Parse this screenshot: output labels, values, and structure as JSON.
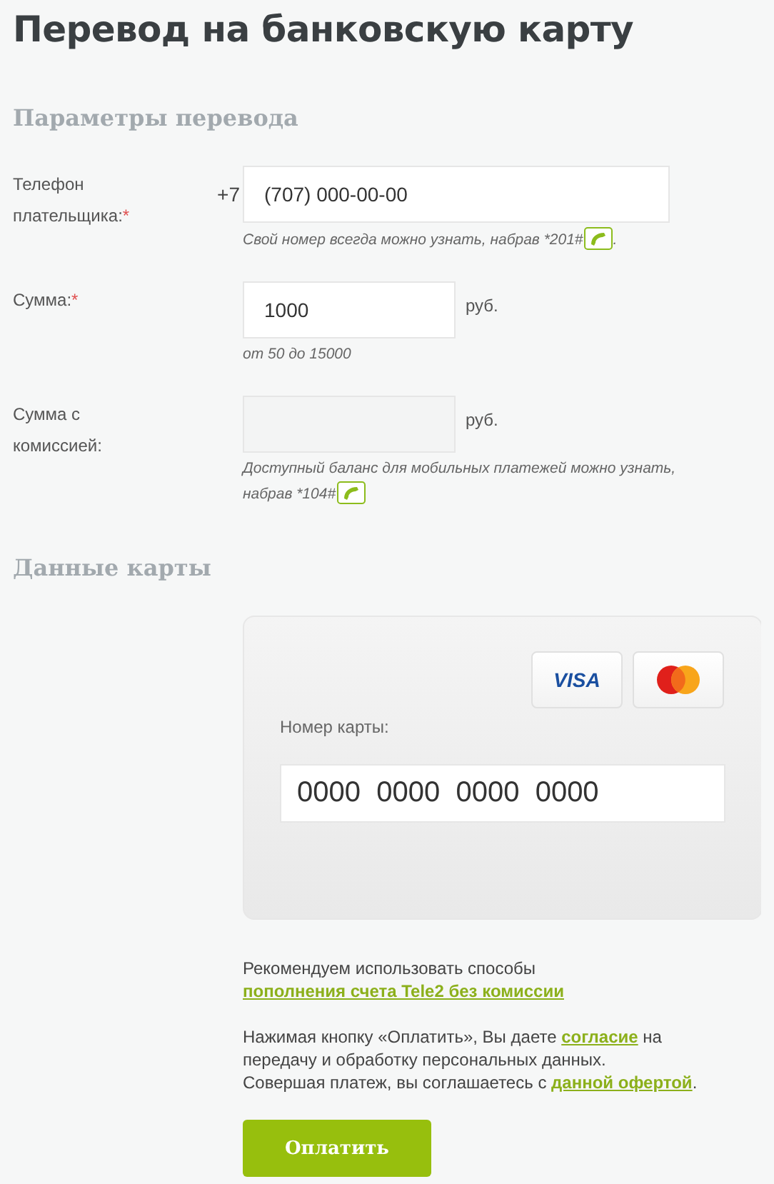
{
  "title": "Перевод на банковскую карту",
  "params_heading": "Параметры перевода",
  "fields": [
    {
      "kind": "phone",
      "label": "Телефон плательщика:",
      "required_mark": "*",
      "prefix": "+7",
      "value": "(707) 000-00-00",
      "hint": "Свой номер всегда можно узнать, набрав *201#",
      "call_icon": true,
      "hint_after": "."
    },
    {
      "kind": "amount",
      "label": "Сумма:",
      "required_mark": "*",
      "value": "1000",
      "unit": "руб.",
      "hint": "от 50 до 15000"
    },
    {
      "kind": "amount",
      "label": "Сумма с комиссией:",
      "disabled": true,
      "unit": "руб.",
      "hint": "Доступный баланс для мобильных платежей можно узнать,",
      "hint_line2": "набрав *104#",
      "call_icon": true
    }
  ],
  "card_heading": "Данные карты",
  "card": {
    "visa": "VISA",
    "number_label": "Номер карты:",
    "number_placeholder": "0000  0000  0000  0000"
  },
  "recommend": {
    "text": "Рекомендуем использовать способы ",
    "link": "пополнения счета Tele2 без комиссии"
  },
  "consent": {
    "before": "Нажимая кнопку «Оплатить», Вы даете ",
    "link": "согласие",
    "after": " на передачу и обработку персональных данных.",
    "before2": "Совершая платеж, вы соглашаетесь с ",
    "link2": "данной офертой",
    "after2": "."
  },
  "pay_button": "Оплатить"
}
